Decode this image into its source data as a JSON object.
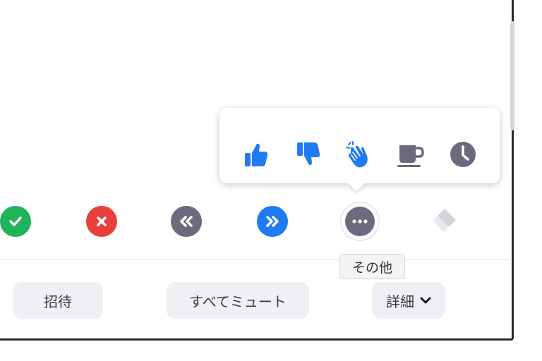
{
  "colors": {
    "accent_blue": "#1e7bf2",
    "reaction_gray": "#6b6b7d",
    "green": "#1fb35a",
    "red": "#e8413b",
    "disabled": "#d4d4da"
  },
  "reactions": [
    {
      "name": "thumbs-up-icon"
    },
    {
      "name": "thumbs-down-icon"
    },
    {
      "name": "clapping-hands-icon"
    },
    {
      "name": "coffee-cup-icon"
    },
    {
      "name": "clock-icon"
    }
  ],
  "status_buttons": [
    {
      "name": "yes-icon"
    },
    {
      "name": "no-icon"
    },
    {
      "name": "go-slower-icon"
    },
    {
      "name": "go-faster-icon"
    },
    {
      "name": "more-icon"
    },
    {
      "name": "clear-icon"
    }
  ],
  "tooltip": {
    "text": "その他"
  },
  "footer": {
    "invite_label": "招待",
    "mute_all_label": "すべてミュート",
    "more_label": "詳細"
  }
}
